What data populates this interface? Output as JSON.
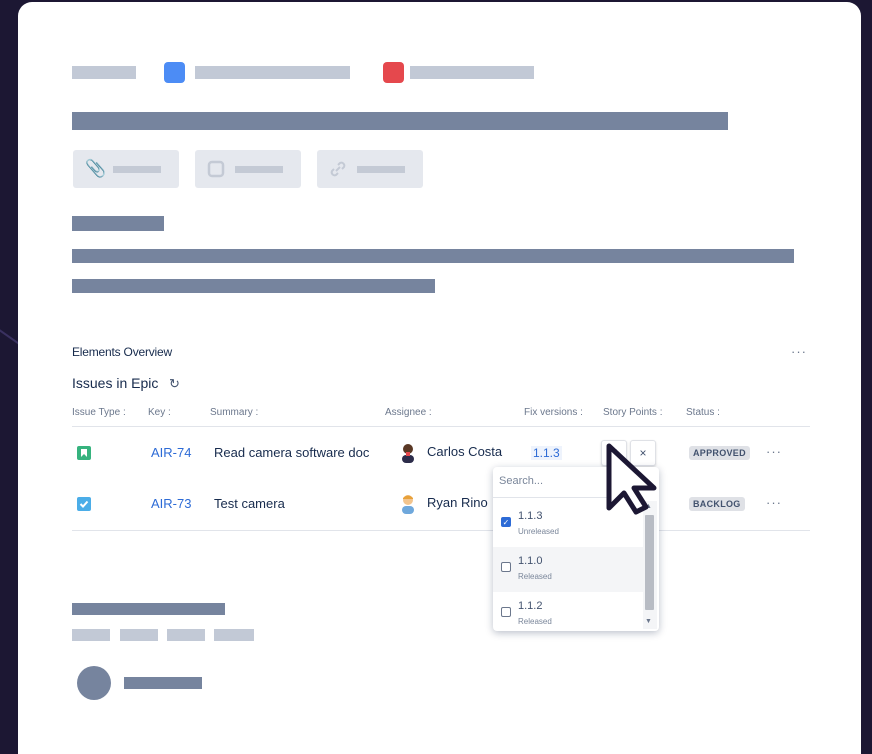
{
  "overview": {
    "title": "Elements Overview",
    "more": "···"
  },
  "epic": {
    "title": "Issues in Epic",
    "refresh_icon": "refresh-icon"
  },
  "columns": [
    "Issue Type :",
    "Key :",
    "Summary :",
    "Assignee :",
    "Fix versions :",
    "Story Points :",
    "Status :"
  ],
  "rows": [
    {
      "type": "story",
      "key": "AIR-74",
      "summary": "Read camera software doc",
      "assignee": "Carlos Costa",
      "fix_version": "1.1.3",
      "status": "APPROVED",
      "more": "···"
    },
    {
      "type": "task",
      "key": "AIR-73",
      "summary": "Test camera",
      "assignee": "Ryan Rino",
      "status": "BACKLOG",
      "more": "···"
    }
  ],
  "inline_edit": {
    "confirm": "✓",
    "cancel": "×"
  },
  "fix_version_dropdown": {
    "placeholder": "Search...",
    "options": [
      {
        "version": "1.1.3",
        "state": "Unreleased",
        "checked": true
      },
      {
        "version": "1.1.0",
        "state": "Released",
        "checked": false
      },
      {
        "version": "1.1.2",
        "state": "Released",
        "checked": false
      }
    ]
  },
  "colors": {
    "background": "#1c1733",
    "card": "#ffffff",
    "placeholder": "#76849e",
    "link": "#2d6bd6",
    "story": "#36b37e",
    "task": "#4bade8",
    "priority_blue": "#4c8cf5",
    "priority_red": "#e5484d"
  }
}
